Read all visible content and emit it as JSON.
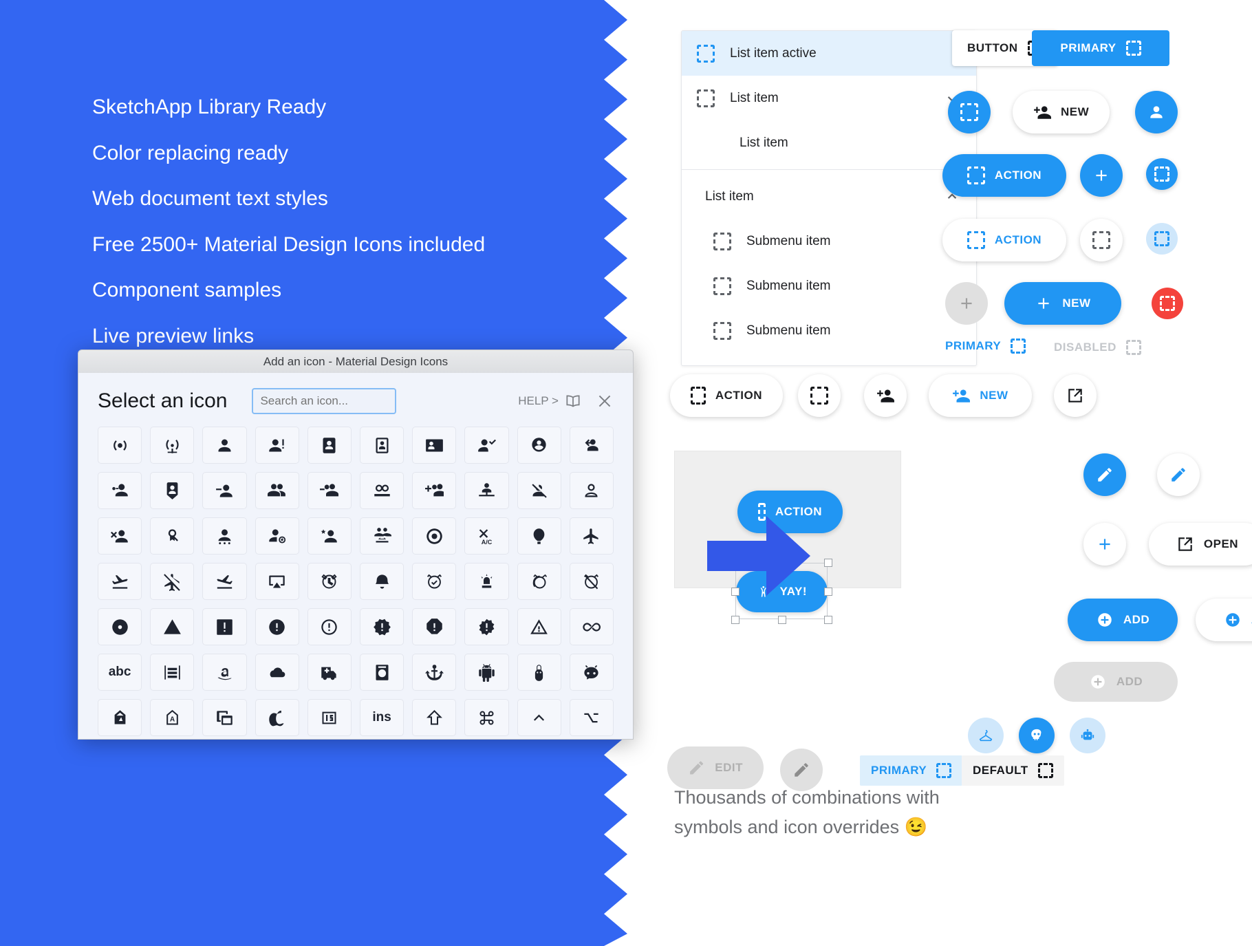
{
  "promo": {
    "features": [
      "SketchApp Library Ready",
      "Color replacing ready",
      "Web document text styles",
      "Free 2500+ Material Design Icons included",
      "Component samples",
      "Live preview links"
    ]
  },
  "list_card": {
    "items": [
      {
        "label": "List item active",
        "state": "active",
        "icon": "placeholder-icon",
        "chevron": ""
      },
      {
        "label": "List item",
        "state": "default",
        "icon": "placeholder-icon",
        "chevron": "chevron-down-icon"
      },
      {
        "label": "List item",
        "state": "nested",
        "icon": "",
        "chevron": ""
      },
      {
        "label": "List item",
        "state": "group",
        "icon": "",
        "chevron": "chevron-up-icon"
      },
      {
        "label": "Submenu item",
        "state": "sub",
        "icon": "placeholder-icon",
        "chevron": ""
      },
      {
        "label": "Submenu item",
        "state": "sub",
        "icon": "placeholder-icon",
        "chevron": ""
      },
      {
        "label": "Submenu item",
        "state": "sub",
        "icon": "placeholder-icon",
        "chevron": ""
      }
    ]
  },
  "buttons": {
    "button": "BUTTON",
    "primary": "PRIMARY",
    "new": "NEW",
    "action": "ACTION",
    "disabled": "DISABLED",
    "open": "OPEN",
    "add": "ADD",
    "edit": "EDIT",
    "default": "DEFAULT",
    "yay": "YAY!"
  },
  "artboard": {
    "action_label": "ACTION",
    "yay_label": "YAY!"
  },
  "caption": {
    "line1": "Thousands of combinations with",
    "line2": "symbols and icon overrides 😉"
  },
  "dialog": {
    "window_title": "Add an icon - Material Design Icons",
    "heading": "Select an icon",
    "search_placeholder": "Search an icon...",
    "search_value": "",
    "help_label": "HELP >",
    "help_icon": "book-icon",
    "close_icon": "close-icon",
    "icons": [
      "access-point-network-icon",
      "access-point-icon",
      "account-icon",
      "account-alert-icon",
      "account-box-icon",
      "account-box-outline-icon",
      "account-card-details-icon",
      "account-check-icon",
      "account-circle-icon",
      "account-convert-icon",
      "account-edit-icon",
      "account-key-icon",
      "account-location-icon",
      "account-minus-icon",
      "account-multiple-icon",
      "account-multiple-minus-icon",
      "account-multiple-outline-icon",
      "account-multiple-plus-icon",
      "account-network-icon",
      "account-off-icon",
      "account-outline-icon",
      "account-plus-icon",
      "account-remove-icon",
      "account-search-icon",
      "account-settings-variant-icon",
      "account-settings-icon",
      "account-star-icon",
      "account-switch-icon",
      "adjust-icon",
      "air-conditioner-icon",
      "air-balloon-icon",
      "airplane-icon",
      "airplane-landing-icon",
      "airplane-off-icon",
      "airplane-takeoff-icon",
      "airplay-icon",
      "alarm-icon",
      "alarm-bell-icon",
      "alarm-check-icon",
      "alarm-light-icon",
      "alarm-multiple-icon",
      "alarm-off-icon",
      "alarm-plus-icon",
      "alarm-snooze-icon",
      "album-icon",
      "alert-icon",
      "alert-box-icon",
      "alert-circle-icon",
      "alert-circle-outline-icon",
      "alert-decagram-icon",
      "alert-octagon-icon",
      "alert-octagram-icon",
      "alert-outline-icon",
      "all-inclusive-icon",
      "alpha-icon",
      "alphabetical-icon",
      "align-horizontal-icon",
      "amazon-icon",
      "amazon-clouddrive-icon",
      "ambulance-icon",
      "amplifier-icon",
      "anchor-icon",
      "android-icon",
      "android-debug-bridge-icon",
      "android-head-icon",
      "angular-icon",
      "apple-icon",
      "apple-outline-icon",
      "application-icon",
      "apple-finder-icon",
      "apple-ios-icon",
      "apple-ins-icon",
      "apple-keyboard-shift-icon",
      "apple-keyboard-command-icon",
      "apple-keyboard-control-icon",
      "apple-keyboard-option-icon",
      "apple-keyboard-caps-icon"
    ]
  }
}
